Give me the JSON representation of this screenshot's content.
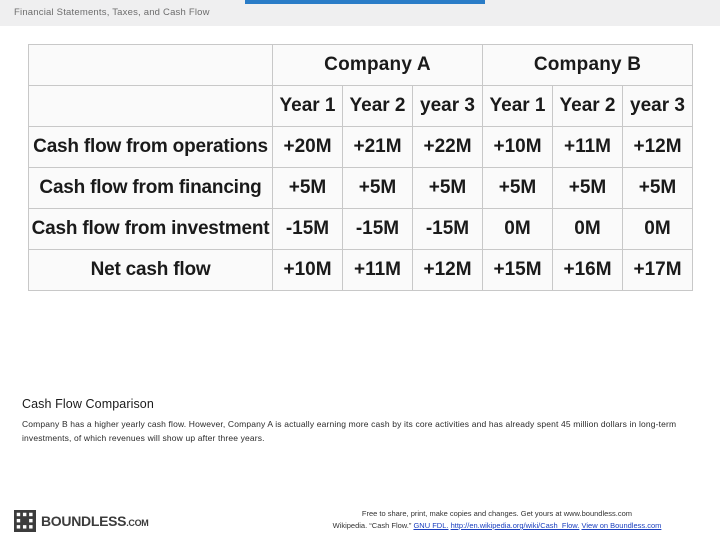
{
  "topbar": {
    "title": "Financial Statements, Taxes, and Cash Flow",
    "accent_color": "#2a7cc7"
  },
  "table": {
    "corner_label": "",
    "company_headers": [
      "Company A",
      "Company B"
    ],
    "year_headers": [
      "Year 1",
      "Year 2",
      "year 3",
      "Year 1",
      "Year 2",
      "year 3"
    ],
    "rows": [
      {
        "label": "Cash flow from operations",
        "values": [
          "+20M",
          "+21M",
          "+22M",
          "+10M",
          "+11M",
          "+12M"
        ]
      },
      {
        "label": "Cash flow from financing",
        "values": [
          "+5M",
          "+5M",
          "+5M",
          "+5M",
          "+5M",
          "+5M"
        ]
      },
      {
        "label": "Cash flow from investment",
        "values": [
          "-15M",
          "-15M",
          "-15M",
          "0M",
          "0M",
          "0M"
        ]
      },
      {
        "label": "Net cash flow",
        "values": [
          "+10M",
          "+11M",
          "+12M",
          "+15M",
          "+16M",
          "+17M"
        ]
      }
    ]
  },
  "content": {
    "heading": "Cash Flow Comparison",
    "body": "Company B has a higher yearly cash flow. However, Company A is actually earning more cash by its core activities and has already spent 45 million dollars in long-term investments, of which revenues will show up after three years."
  },
  "footer": {
    "brand": "BOUNDLESS",
    "brand_suffix": ".COM",
    "line1": "Free to share, print, make copies and changes. Get yours at www.boundless.com",
    "line2_prefix": "Wikipedia.",
    "line2_quote": "“Cash Flow.”",
    "link1": "GNU FDL.",
    "link2": "http://en.wikipedia.org/wiki/Cash_Flow.",
    "link3": "View on Boundless.com"
  }
}
